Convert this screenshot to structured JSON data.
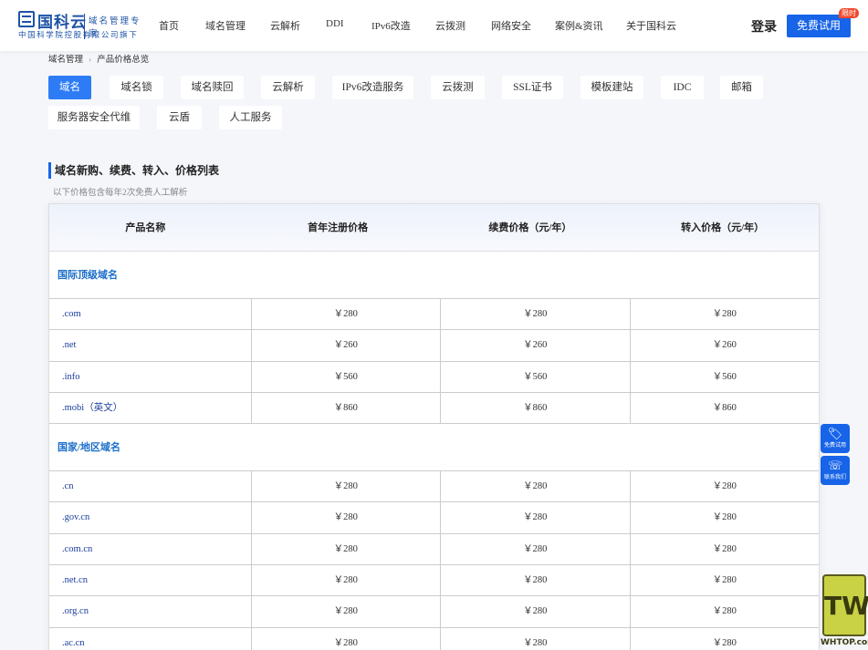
{
  "header": {
    "logo_text": "国科云",
    "logo_tag": "域名管理专家",
    "logo_sub": "中国科学院控股有限公司旗下",
    "nav": [
      "首页",
      "域名管理",
      "云解析",
      "DDI",
      "IPv6改造",
      "云拨测",
      "网络安全",
      "案例&资讯",
      "关于国科云"
    ],
    "login_label": "登录",
    "trial_label": "免费试用",
    "trial_badge": "限时"
  },
  "breadcrumb": [
    "域名管理",
    "产品价格总览"
  ],
  "tabs": [
    "域名",
    "域名锁",
    "域名赎回",
    "云解析",
    "IPv6改造服务",
    "云拨测",
    "SSL证书",
    "模板建站",
    "IDC",
    "邮箱",
    "服务器安全代维",
    "云盾",
    "人工服务"
  ],
  "active_tab": "域名",
  "section": {
    "title": "域名新购、续费、转入、价格列表",
    "note": "以下价格包含每年2次免费人工解析"
  },
  "table": {
    "headers": [
      "产品名称",
      "首年注册价格",
      "续费价格（元/年）",
      "转入价格（元/年）"
    ],
    "groups": [
      {
        "title": "国际顶级域名",
        "rows": [
          [
            ".com",
            "￥280",
            "￥280",
            "￥280"
          ],
          [
            ".net",
            "￥260",
            "￥260",
            "￥260"
          ],
          [
            ".info",
            "￥560",
            "￥560",
            "￥560"
          ],
          [
            ".mobi（英文）",
            "￥860",
            "￥860",
            "￥860"
          ]
        ]
      },
      {
        "title": "国家/地区域名",
        "rows": [
          [
            ".cn",
            "￥280",
            "￥280",
            "￥280"
          ],
          [
            ".gov.cn",
            "￥280",
            "￥280",
            "￥280"
          ],
          [
            ".com.cn",
            "￥280",
            "￥280",
            "￥280"
          ],
          [
            ".net.cn",
            "￥280",
            "￥280",
            "￥280"
          ],
          [
            ".org.cn",
            "￥280",
            "￥280",
            "￥280"
          ],
          [
            ".ac.cn",
            "￥280",
            "￥280",
            "￥280"
          ]
        ]
      }
    ]
  },
  "side": {
    "trial_label": "免费试用",
    "contact_label": "联系我们"
  },
  "watermark": "WHTOP.com",
  "colors": {
    "primary": "#1764e8",
    "tab_active": "#2d7cf6",
    "group_title": "#1a6ec9",
    "badge": "#f04a2d"
  }
}
